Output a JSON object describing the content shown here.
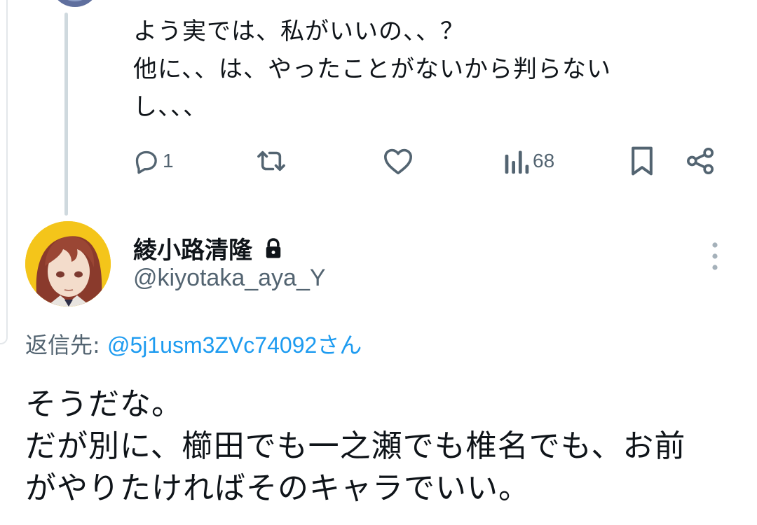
{
  "parent_tweet": {
    "text_lines": [
      "よう実では、私がいいの、、？",
      "他に、、は、やったことがないから判らない",
      "し、、、"
    ],
    "actions": {
      "reply_count": "1",
      "retweet_count": "",
      "like_count": "",
      "views_count": "68"
    }
  },
  "reply_tweet": {
    "display_name": "綾小路清隆",
    "handle": "@kiyotaka_aya_Y",
    "reply_to_label": "返信先: ",
    "reply_to_mention": "@5j1usm3ZVc74092さん",
    "text_lines": [
      "そうだな。",
      "だが別に、櫛田でも一之瀬でも椎名でも、お前",
      "がやりたければそのキャラでいい。"
    ]
  },
  "icons": {
    "reply": "reply-icon",
    "retweet": "retweet-icon",
    "like": "heart-icon",
    "views": "views-icon",
    "bookmark": "bookmark-icon",
    "share": "share-icon",
    "lock": "lock-icon",
    "more": "more-vertical-icon"
  },
  "colors": {
    "icon_gray": "#536471",
    "mention_blue": "#1d9bf0",
    "avatar_bg": "#f4c51a",
    "thread_line": "#cfd9de"
  }
}
